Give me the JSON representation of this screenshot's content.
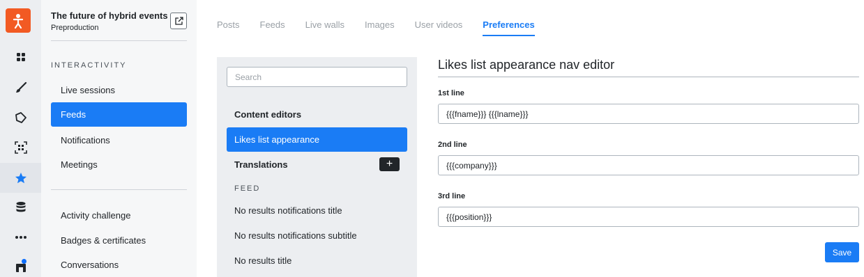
{
  "rail": {
    "items": [
      {
        "icon": "grid-icon",
        "active": false
      },
      {
        "icon": "brush-icon",
        "active": false
      },
      {
        "icon": "tag-icon",
        "active": false
      },
      {
        "icon": "qr-scan-icon",
        "active": false
      },
      {
        "icon": "star-icon",
        "active": true
      },
      {
        "icon": "database-icon",
        "active": false
      },
      {
        "icon": "more-icon",
        "active": false
      },
      {
        "icon": "store-icon",
        "active": false
      }
    ],
    "accent_color": "#f25a23"
  },
  "sidebar": {
    "event_title": "The future of hybrid events",
    "event_subtitle": "Preproduction",
    "section_heading": "INTERACTIVITY",
    "items": [
      {
        "label": "Live sessions"
      },
      {
        "label": "Feeds"
      },
      {
        "label": "Notifications"
      },
      {
        "label": "Meetings"
      }
    ],
    "items2": [
      {
        "label": "Activity challenge"
      },
      {
        "label": "Badges & certificates"
      },
      {
        "label": "Conversations"
      }
    ],
    "active_label": "Feeds"
  },
  "tabs": [
    {
      "label": "Posts"
    },
    {
      "label": "Feeds"
    },
    {
      "label": "Live walls"
    },
    {
      "label": "Images"
    },
    {
      "label": "User videos"
    },
    {
      "label": "Preferences"
    }
  ],
  "active_tab": "Preferences",
  "left_panel": {
    "search_placeholder": "Search",
    "group_content_editors": "Content editors",
    "active_item": "Likes list appearance",
    "group_translations": "Translations",
    "add_label": "+",
    "section_feed": "FEED",
    "feed_items": [
      {
        "label": "No results notifications title"
      },
      {
        "label": "No results notifications subtitle"
      },
      {
        "label": "No results title"
      }
    ]
  },
  "editor": {
    "title": "Likes list appearance nav editor",
    "fields": [
      {
        "label": "1st line",
        "value": "{{{fname}}} {{{lname}}}"
      },
      {
        "label": "2nd line",
        "value": "{{{company}}}"
      },
      {
        "label": "3rd line",
        "value": "{{{position}}}"
      }
    ],
    "save_label": "Save"
  },
  "colors": {
    "primary": "#1a7cf5",
    "sidebar_bg": "#f6f7f8",
    "rail_bg": "#eceef1"
  }
}
